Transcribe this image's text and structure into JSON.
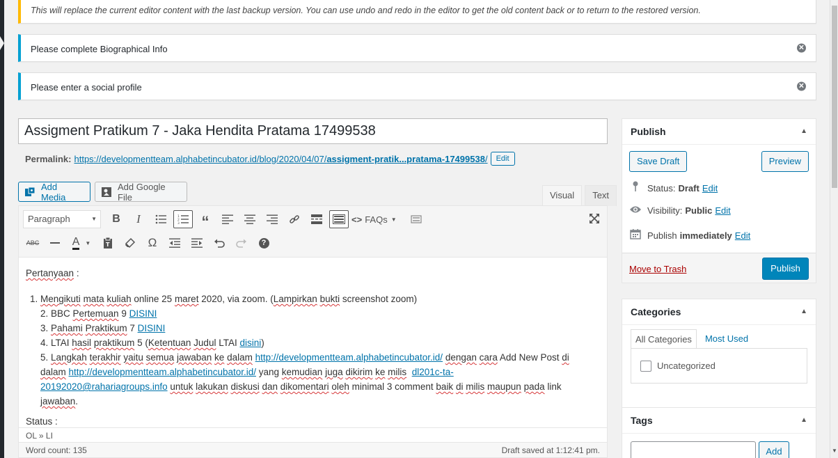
{
  "notices": {
    "restore": "This will replace the current editor content with the last backup version. You can use undo and redo in the editor to get the old content back or to return to the restored version.",
    "bio": "Please complete Biographical Info",
    "social": "Please enter a social profile"
  },
  "post": {
    "title": "Assigment Pratikum 7 - Jaka Hendita Pratama 17499538",
    "permalink_label": "Permalink:",
    "permalink_url_base": "https://developmentteam.alphabetincubator.id/blog/2020/04/07/",
    "permalink_slug": "assigment-pratik...pratama-17499538",
    "permalink_trailing": "/",
    "edit_label": "Edit"
  },
  "media": {
    "add_media": "Add Media",
    "add_google_file": "Add Google File"
  },
  "editor": {
    "tab_visual": "Visual",
    "tab_text": "Text",
    "format_select": "Paragraph",
    "faqs_label": "FAQs",
    "path": "OL » LI",
    "word_count": "Word count: 135",
    "draft_saved": "Draft saved at 1:12:41 pm."
  },
  "content": {
    "line0_a": "Pertanyaan",
    "line0_b": " :",
    "item1": {
      "num": "1. ",
      "w1": "Mengikuti",
      "s1": " ",
      "w2": "mata",
      "s2": " ",
      "w3": "kuliah",
      "t1": " online 25 ",
      "w4": "maret",
      "t2": " 2020, via zoom. (",
      "w5": "Lampirkan",
      "s3": " ",
      "w6": "bukti",
      "t3": " screenshot zoom)"
    },
    "item2": {
      "num": "2. ",
      "t1": "BBC ",
      "w1": "Pertemuan",
      "t2": " 9 ",
      "link": "DISINI"
    },
    "item3": {
      "num": "3. ",
      "w1": "Pahami",
      "s1": " ",
      "w2": "Praktikum",
      "t1": " 7 ",
      "link": "DISINI"
    },
    "item4": {
      "num": "4. ",
      "t1": "LTAI ",
      "w1": "hasil",
      "s1": " ",
      "w2": "praktikum",
      "t2": " 5 (",
      "w3": "Ketentuan",
      "s2": " ",
      "w4": "Judul",
      "t3": " LTAI ",
      "link": "disini",
      "t4": ")"
    },
    "item5": {
      "num": "5. ",
      "w1": "Langkah",
      "w2": "terakhir",
      "w3": "yaitu",
      "w4": "semua",
      "w5": "jawaban",
      "w6": "ke",
      "w7": "dalam",
      "link1": "http://developmentteam.alphabetincubator.id/",
      "w8": "dengan",
      "w9": "cara",
      "t1": " Add New Post ",
      "w10": "di",
      "w11": "dalam",
      "link2": "http://developmentteam.alphabetincubator.id/",
      "t2": " yang ",
      "w12": "kemudian",
      "w13": "juga",
      "w14": "dikirim",
      "w15": "ke",
      "w16": "milis",
      "link3a": "dl201c-ta-",
      "link3b": "20192020@rahariagroups.info",
      "w17": "untuk",
      "w18": "lakukan",
      "w19": "diskusi",
      "w20": "dan",
      "w21": "dikomentari",
      "w22": "oleh",
      "t3": " minimal 3 comment ",
      "w23": "baik",
      "w24": "di",
      "w25": "milis",
      "w26": "maupun",
      "w27": "pada",
      "t4": " link",
      "w28": "jawaban",
      "t5": "."
    },
    "next": "Status :"
  },
  "publish_box": {
    "title": "Publish",
    "save_draft": "Save Draft",
    "preview": "Preview",
    "status_label": "Status:",
    "status_value": "Draft",
    "visibility_label": "Visibility:",
    "visibility_value": "Public",
    "publish_label": "Publish",
    "publish_value": "immediately",
    "edit": "Edit",
    "move_to_trash": "Move to Trash",
    "publish_button": "Publish"
  },
  "categories_box": {
    "title": "Categories",
    "tab_all": "All Categories",
    "tab_most": "Most Used",
    "items": [
      {
        "label": "Uncategorized",
        "checked": false
      }
    ]
  },
  "tags_box": {
    "title": "Tags",
    "add": "Add"
  },
  "colors": {
    "accent": "#0073aa",
    "primary_button": "#0085ba",
    "warning": "#ffb900",
    "info": "#00a0d2",
    "trash": "#aa0000"
  }
}
